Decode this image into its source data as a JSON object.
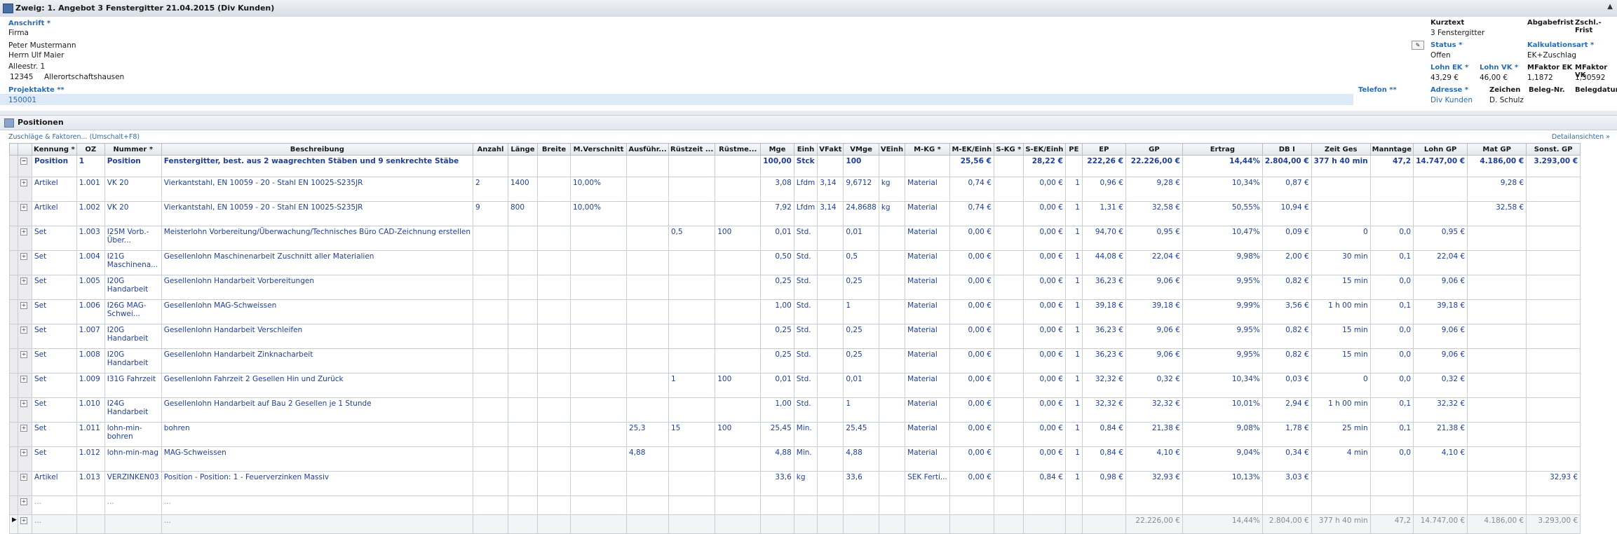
{
  "window": {
    "title": "Zweig: 1. Angebot 3 Fenstergitter 21.04.2015 (Div Kunden)"
  },
  "header": {
    "anschrift_label": "Anschrift *",
    "anschrift_lines": [
      "Firma",
      "Peter Mustermann",
      "Herrn Ulf Maier",
      "Alleestr. 1"
    ],
    "plz": "12345",
    "ort": "Allerortschaftshausen",
    "projektakte_label": "Projektakte **",
    "projektakte_value": "150001",
    "telefon_label": "Telefon **",
    "kurztext_label": "Kurztext",
    "kurztext_value": "3 Fenstergitter",
    "abgabefrist_label": "Abgabefrist",
    "zschl_label": "Zschl.-Frist",
    "status_label": "Status *",
    "status_value": "Offen",
    "kalkulationsart_label": "Kalkulationsart *",
    "kalkulationsart_value": "EK+Zuschlag",
    "lohn_ek_label": "Lohn EK *",
    "lohn_ek_value": "43,29 €",
    "lohn_vk_label": "Lohn VK *",
    "lohn_vk_value": "46,00 €",
    "mfaktor_ek_label": "MFaktor EK",
    "mfaktor_ek_value": "1,1872",
    "mfaktor_vk_label": "MFaktor VK",
    "mfaktor_vk_value": "1,30592",
    "adresse_label": "Adresse *",
    "adresse_value": "Div Kunden",
    "zeichen_label": "Zeichen",
    "zeichen_value": "D. Schulz",
    "beleg_nr_label": "Beleg-Nr.",
    "belegdatum_label": "Belegdatum"
  },
  "positions": {
    "section_title": "Positionen",
    "link_left": "Zuschläge & Faktoren... (Umschalt+F8)",
    "link_right": "Detailansichten »",
    "columns": [
      "Kennung *",
      "OZ",
      "Nummer *",
      "Beschreibung",
      "Anzahl",
      "Länge",
      "Breite",
      "M.Verschnitt",
      "Ausführ...",
      "Rüstzeit ...",
      "Rüstme...",
      "Mge",
      "Einh",
      "VFakt",
      "VMge",
      "VEinh",
      "M-KG *",
      "M-EK/Einh",
      "S-KG *",
      "S-EK/Einh",
      "PE",
      "EP",
      "GP",
      "Ertrag",
      "DB I",
      "Zeit Ges",
      "Manntage",
      "Lohn GP",
      "Mat GP",
      "Sonst. GP"
    ],
    "rows": [
      {
        "type": "pos",
        "cells": [
          "Position",
          "1",
          "Position",
          "Fenstergitter, best. aus 2 waagrechten Stäben und 9 senkrechte Stäbe",
          "",
          "",
          "",
          "",
          "",
          "",
          "",
          "100,00",
          "Stck",
          "",
          "100",
          "",
          "",
          "25,56 €",
          "",
          "28,22 €",
          "",
          "222,26 €",
          "22.226,00 €",
          "14,44%",
          "2.804,00 €",
          "377 h 40 min",
          "47,2",
          "14.747,00 €",
          "4.186,00 €",
          "3.293,00 €"
        ]
      },
      {
        "type": "art",
        "cells": [
          "Artikel",
          "1.001",
          "VK 20",
          "Vierkantstahl, EN 10059 -  20 - Stahl EN 10025-S235JR",
          "2",
          "1400",
          "",
          "10,00%",
          "",
          "",
          "",
          "3,08",
          "Lfdm",
          "3,14",
          "9,6712",
          "kg",
          "Material",
          "0,74 €",
          "",
          "0,00 €",
          "1",
          "0,96 €",
          "9,28 €",
          "10,34%",
          "0,87 €",
          "",
          "",
          "",
          "9,28 €",
          ""
        ]
      },
      {
        "type": "art",
        "cells": [
          "Artikel",
          "1.002",
          "VK 20",
          "Vierkantstahl, EN 10059 -  20 - Stahl EN 10025-S235JR",
          "9",
          "800",
          "",
          "10,00%",
          "",
          "",
          "",
          "7,92",
          "Lfdm",
          "3,14",
          "24,8688",
          "kg",
          "Material",
          "0,74 €",
          "",
          "0,00 €",
          "1",
          "1,31 €",
          "32,58 €",
          "50,55%",
          "10,94 €",
          "",
          "",
          "",
          "32,58 €",
          ""
        ]
      },
      {
        "type": "set",
        "cells": [
          "Set",
          "1.003",
          "I25M Vorb.-Über...",
          "Meisterlohn Vorbereitung/Überwachung/Technisches Büro CAD-Zeichnung erstellen",
          "",
          "",
          "",
          "",
          "",
          "0,5",
          "100",
          "0,01",
          "Std.",
          "",
          "0,01",
          "",
          "Material",
          "0,00 €",
          "",
          "0,00 €",
          "1",
          "94,70 €",
          "0,95 €",
          "10,47%",
          "0,09 €",
          "0",
          "0,0",
          "0,95 €",
          "",
          ""
        ]
      },
      {
        "type": "set",
        "cells": [
          "Set",
          "1.004",
          "I21G Maschinena...",
          "Gesellenlohn Maschinenarbeit Zuschnitt aller Materialien",
          "",
          "",
          "",
          "",
          "",
          "",
          "",
          "0,50",
          "Std.",
          "",
          "0,5",
          "",
          "Material",
          "0,00 €",
          "",
          "0,00 €",
          "1",
          "44,08 €",
          "22,04 €",
          "9,98%",
          "2,00 €",
          "30 min",
          "0,1",
          "22,04 €",
          "",
          ""
        ]
      },
      {
        "type": "set",
        "cells": [
          "Set",
          "1.005",
          "I20G Handarbeit",
          "Gesellenlohn Handarbeit Vorbereitungen",
          "",
          "",
          "",
          "",
          "",
          "",
          "",
          "0,25",
          "Std.",
          "",
          "0,25",
          "",
          "Material",
          "0,00 €",
          "",
          "0,00 €",
          "1",
          "36,23 €",
          "9,06 €",
          "9,95%",
          "0,82 €",
          "15 min",
          "0,0",
          "9,06 €",
          "",
          ""
        ]
      },
      {
        "type": "set",
        "cells": [
          "Set",
          "1.006",
          "I26G MAG-Schwei...",
          "Gesellenlohn MAG-Schweissen",
          "",
          "",
          "",
          "",
          "",
          "",
          "",
          "1,00",
          "Std.",
          "",
          "1",
          "",
          "Material",
          "0,00 €",
          "",
          "0,00 €",
          "1",
          "39,18 €",
          "39,18 €",
          "9,99%",
          "3,56 €",
          "1 h 00 min",
          "0,1",
          "39,18 €",
          "",
          ""
        ]
      },
      {
        "type": "set",
        "cells": [
          "Set",
          "1.007",
          "I20G Handarbeit",
          "Gesellenlohn Handarbeit Verschleifen",
          "",
          "",
          "",
          "",
          "",
          "",
          "",
          "0,25",
          "Std.",
          "",
          "0,25",
          "",
          "Material",
          "0,00 €",
          "",
          "0,00 €",
          "1",
          "36,23 €",
          "9,06 €",
          "9,95%",
          "0,82 €",
          "15 min",
          "0,0",
          "9,06 €",
          "",
          ""
        ]
      },
      {
        "type": "set",
        "cells": [
          "Set",
          "1.008",
          "I20G Handarbeit",
          "Gesellenlohn Handarbeit Zinknacharbeit",
          "",
          "",
          "",
          "",
          "",
          "",
          "",
          "0,25",
          "Std.",
          "",
          "0,25",
          "",
          "Material",
          "0,00 €",
          "",
          "0,00 €",
          "1",
          "36,23 €",
          "9,06 €",
          "9,95%",
          "0,82 €",
          "15 min",
          "0,0",
          "9,06 €",
          "",
          ""
        ]
      },
      {
        "type": "set",
        "cells": [
          "Set",
          "1.009",
          "I31G Fahrzeit",
          "Gesellenlohn Fahrzeit 2 Gesellen Hin und Zurück",
          "",
          "",
          "",
          "",
          "",
          "1",
          "100",
          "0,01",
          "Std.",
          "",
          "0,01",
          "",
          "Material",
          "0,00 €",
          "",
          "0,00 €",
          "1",
          "32,32 €",
          "0,32 €",
          "10,34%",
          "0,03 €",
          "0",
          "0,0",
          "0,32 €",
          "",
          ""
        ]
      },
      {
        "type": "set",
        "cells": [
          "Set",
          "1.010",
          "I24G Handarbeit",
          "Gesellenlohn Handarbeit auf Bau 2 Gesellen je 1 Stunde",
          "",
          "",
          "",
          "",
          "",
          "",
          "",
          "1,00",
          "Std.",
          "",
          "1",
          "",
          "Material",
          "0,00 €",
          "",
          "0,00 €",
          "1",
          "32,32 €",
          "32,32 €",
          "10,01%",
          "2,94 €",
          "1 h 00 min",
          "0,1",
          "32,32 €",
          "",
          ""
        ]
      },
      {
        "type": "set",
        "cells": [
          "Set",
          "1.011",
          "lohn-min-bohren",
          "bohren",
          "",
          "",
          "",
          "",
          "25,3",
          "15",
          "100",
          "25,45",
          "Min.",
          "",
          "25,45",
          "",
          "Material",
          "0,00 €",
          "",
          "0,00 €",
          "1",
          "0,84 €",
          "21,38 €",
          "9,08%",
          "1,78 €",
          "25 min",
          "0,1",
          "21,38 €",
          "",
          ""
        ]
      },
      {
        "type": "set",
        "cells": [
          "Set",
          "1.012",
          "lohn-min-mag",
          "MAG-Schweissen",
          "",
          "",
          "",
          "",
          "4,88",
          "",
          "",
          "4,88",
          "Min.",
          "",
          "4,88",
          "",
          "Material",
          "0,00 €",
          "",
          "0,00 €",
          "1",
          "0,84 €",
          "4,10 €",
          "9,04%",
          "0,34 €",
          "4 min",
          "0,0",
          "4,10 €",
          "",
          ""
        ]
      },
      {
        "type": "art",
        "cells": [
          "Artikel",
          "1.013",
          "VERZINKEN03",
          "Position - Position: 1 - Feuerverzinken Massiv",
          "",
          "",
          "",
          "",
          "",
          "",
          "",
          "33,6",
          "kg",
          "",
          "33,6",
          "",
          "SEK Ferti...",
          "0,00 €",
          "",
          "0,84 €",
          "1",
          "0,98 €",
          "32,93 €",
          "10,13%",
          "3,03 €",
          "",
          "",
          "",
          "",
          "32,93 €"
        ]
      }
    ],
    "empty_row": [
      "...",
      "",
      "...",
      "..."
    ],
    "sum_row": [
      "...",
      "",
      "",
      "...",
      "",
      "",
      "",
      "",
      "",
      "",
      "",
      "",
      "",
      "",
      "",
      "",
      "",
      "",
      "",
      "",
      "",
      "",
      "22.226,00 €",
      "14,44%",
      "2.804,00 €",
      "377 h 40 min",
      "47,2",
      "14.747,00 €",
      "4.186,00 €",
      "3.293,00 €"
    ]
  }
}
